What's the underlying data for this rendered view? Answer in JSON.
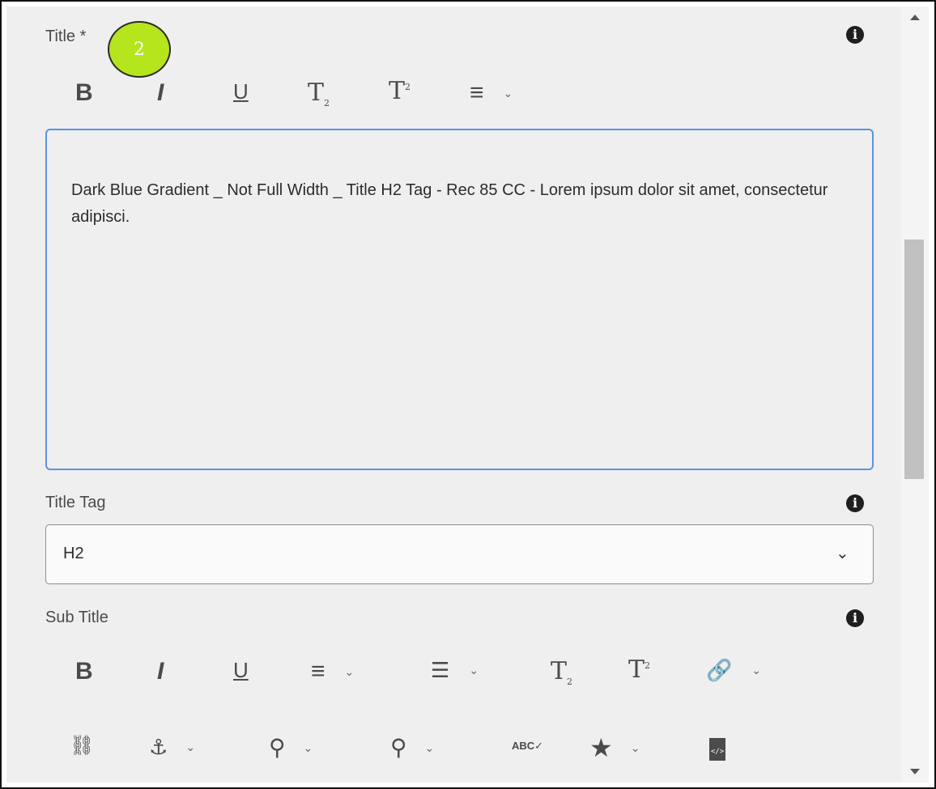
{
  "title_field": {
    "label": "Title *",
    "badge": "2",
    "info_icon": "info-icon",
    "toolbar": {
      "bold": "B",
      "italic": "I",
      "underline": "U",
      "subscript_base": "T",
      "subscript_mark": "2",
      "superscript_base": "T",
      "superscript_mark": "2",
      "align": "≡",
      "chevron": "⌄"
    },
    "value": "Dark Blue Gradient _ Not Full Width _ Title H2 Tag - Rec 85 CC - Lorem ipsum dolor sit amet, consectetur adipisci."
  },
  "title_tag_field": {
    "label": "Title Tag",
    "selected": "H2",
    "chevron": "⌄"
  },
  "subtitle_field": {
    "label": "Sub Title",
    "toolbar_row1": {
      "bold": "B",
      "italic": "I",
      "underline": "U",
      "align": "≡",
      "list": "☰",
      "subscript_base": "T",
      "subscript_mark": "2",
      "superscript_base": "T",
      "superscript_mark": "2",
      "link": "🔗",
      "chevron": "⌄"
    },
    "toolbar_row2": {
      "unlink": "⛓",
      "anchor": "⚓",
      "find": "⚲",
      "find_replace": "⚲",
      "spellcheck": "ABC✓",
      "special_char": "★",
      "source_edit": "</>",
      "chevron": "⌄"
    }
  },
  "colors": {
    "panel_bg": "#efefef",
    "editor_focus_border": "#5b93df",
    "badge_fill": "#b5e51d"
  }
}
